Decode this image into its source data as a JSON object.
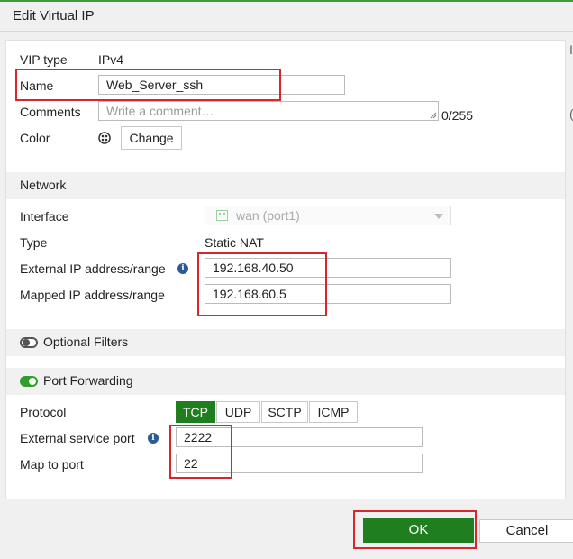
{
  "window": {
    "title": "Edit Virtual IP"
  },
  "fields": {
    "vip_type_label": "VIP type",
    "vip_type_value": "IPv4",
    "name_label": "Name",
    "name_value": "Web_Server_ssh",
    "comments_label": "Comments",
    "comments_placeholder": "Write a comment…",
    "comments_counter": "0/255",
    "color_label": "Color",
    "change_button": "Change"
  },
  "network": {
    "section_title": "Network",
    "interface_label": "Interface",
    "interface_value": "wan (port1)",
    "type_label": "Type",
    "type_value": "Static NAT",
    "external_ip_label": "External IP address/range",
    "external_ip_value": "192.168.40.50",
    "mapped_ip_label": "Mapped IP address/range",
    "mapped_ip_value": "192.168.60.5"
  },
  "optional_filters": {
    "label": "Optional Filters",
    "enabled": false
  },
  "port_forwarding": {
    "label": "Port Forwarding",
    "enabled": true,
    "protocol_label": "Protocol",
    "protocols": [
      "TCP",
      "UDP",
      "SCTP",
      "ICMP"
    ],
    "selected_protocol": "TCP",
    "external_port_label": "External service port",
    "external_port_value": "2222",
    "map_port_label": "Map to port",
    "map_port_value": "22"
  },
  "footer": {
    "ok_label": "OK",
    "cancel_label": "Cancel"
  },
  "colors": {
    "accent_green": "#1f7f1f",
    "highlight_red": "#d7272d",
    "info_blue": "#2a5a96"
  }
}
